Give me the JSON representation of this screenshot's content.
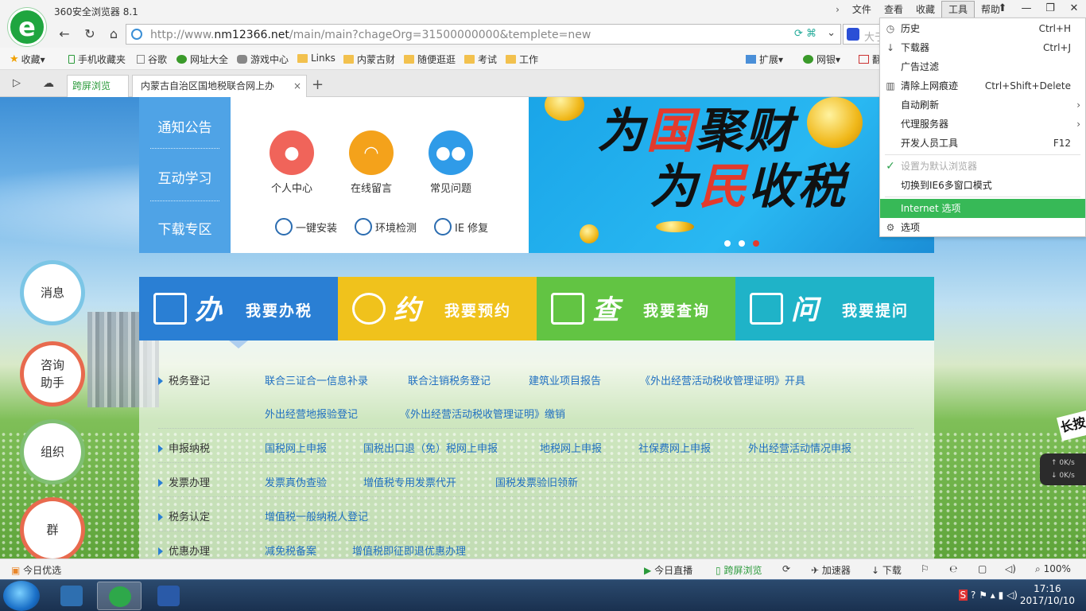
{
  "browser": {
    "app_title": "360安全浏览器 8.1",
    "logo_glyph": "e",
    "menu": [
      "文件",
      "查看",
      "收藏",
      "工具",
      "帮助"
    ],
    "active_menu": "工具",
    "menu_chevron": "›",
    "window_controls": [
      "⬆",
      "—",
      "❐",
      "✕"
    ],
    "url_prefix": "http://www.",
    "url_domain": "nm12366.net",
    "url_rest": "/main/main?chageOrg=31500000000&templete=new",
    "url_icons": "⟳ ⌘",
    "url_dropdown": "⌄",
    "search_text": "大于",
    "nav": {
      "back": "←",
      "reload": "↻",
      "home": "⌂"
    },
    "bookmarks": [
      {
        "label": "收藏",
        "icon": "star-icon"
      },
      {
        "label": "手机收藏夹",
        "icon": "phone-icon"
      },
      {
        "label": "谷歌",
        "icon": "page-icon"
      },
      {
        "label": "网址大全",
        "icon": "globe-icon"
      },
      {
        "label": "游戏中心",
        "icon": "gamepad-icon"
      },
      {
        "label": "Links",
        "icon": "folder-icon"
      },
      {
        "label": "内蒙古财",
        "icon": "folder-icon"
      },
      {
        "label": "随便逛逛",
        "icon": "folder-icon"
      },
      {
        "label": "考试",
        "icon": "folder-icon"
      },
      {
        "label": "工作",
        "icon": "folder-icon"
      }
    ],
    "bookmark_right": {
      "extend": "扩展",
      "bank": "网银",
      "translate": "翻"
    },
    "tabs": {
      "split_label": "跨屏浏览",
      "main_title": "内蒙古自治区国地税联合网上办",
      "close": "×",
      "add": "+"
    }
  },
  "tools_menu": {
    "items": [
      {
        "label": "历史",
        "shortcut": "Ctrl+H",
        "icon": "clock-icon"
      },
      {
        "label": "下载器",
        "shortcut": "Ctrl+J",
        "icon": "download-icon"
      },
      {
        "label": "广告过滤",
        "shortcut": "",
        "icon": ""
      },
      {
        "label": "清除上网痕迹",
        "shortcut": "Ctrl+Shift+Delete",
        "icon": "trash-icon"
      },
      {
        "label": "自动刷新",
        "shortcut": "",
        "icon": "",
        "submenu": true
      },
      {
        "label": "代理服务器",
        "shortcut": "",
        "icon": "",
        "submenu": true
      },
      {
        "label": "开发人员工具",
        "shortcut": "F12",
        "icon": ""
      },
      {
        "label": "设置为默认浏览器",
        "shortcut": "",
        "icon": "check-icon",
        "disabled": true
      },
      {
        "label": "切换到IE6多窗口模式",
        "shortcut": "",
        "icon": ""
      },
      {
        "label": "Internet 选项",
        "shortcut": "",
        "icon": "",
        "highlighted": true
      },
      {
        "label": "选项",
        "shortcut": "",
        "icon": "gear-icon"
      }
    ]
  },
  "page": {
    "side_nav": [
      "通知公告",
      "互动学习",
      "下载专区"
    ],
    "quick": [
      {
        "label": "个人中心",
        "icon": "person-icon",
        "color": "#f0645a"
      },
      {
        "label": "在线留言",
        "icon": "headset-icon",
        "color": "#f4a21b"
      },
      {
        "label": "常见问题",
        "icon": "group-icon",
        "color": "#2f9be8"
      }
    ],
    "tools": [
      "一键安装",
      "环境检测",
      "IE 修复"
    ],
    "banner_line1_a": "为",
    "banner_line1_b": "国",
    "banner_line1_c": "聚财",
    "banner_line2_a": "为",
    "banner_line2_b": "民",
    "banner_line2_c": "收税",
    "bubbles": [
      "消息",
      "咨询\n助手",
      "组织",
      "群"
    ],
    "tiles": [
      {
        "big": "办",
        "small": "我要办税",
        "color": "#2a7fd4"
      },
      {
        "big": "约",
        "small": "我要预约",
        "color": "#f0c21c"
      },
      {
        "big": "查",
        "small": "我要查询",
        "color": "#62c443"
      },
      {
        "big": "问",
        "small": "我要提问",
        "color": "#1fb3c8"
      }
    ],
    "sections": [
      {
        "title": "税务登记",
        "links": [
          "联合三证合一信息补录",
          "联合注销税务登记",
          "建筑业项目报告",
          "《外出经营活动税收管理证明》开具"
        ]
      },
      {
        "title": "",
        "links": [
          "外出经营地报验登记",
          "《外出经营活动税收管理证明》缴销"
        ]
      },
      {
        "title": "申报纳税",
        "links": [
          "国税网上申报",
          "国税出口退（免）税网上申报",
          "地税网上申报",
          "社保费网上申报",
          "外出经营活动情况申报"
        ]
      },
      {
        "title": "发票办理",
        "links": [
          "发票真伪查验",
          "增值税专用发票代开",
          "国税发票验旧领新"
        ]
      },
      {
        "title": "税务认定",
        "links": [
          "增值税一般纳税人登记"
        ]
      },
      {
        "title": "优惠办理",
        "links": [
          "减免税备案",
          "增值税即征即退优惠办理"
        ]
      }
    ],
    "speed": {
      "up": "0K/s",
      "down": "0K/s"
    },
    "side_badge": "长按"
  },
  "statusbar": {
    "left": "今日优选",
    "items": [
      "今日直播",
      "跨屏浏览",
      "加速器",
      "下载"
    ],
    "zoom": "100%"
  },
  "taskbar": {
    "time": "17:16",
    "date": "2017/10/10"
  }
}
